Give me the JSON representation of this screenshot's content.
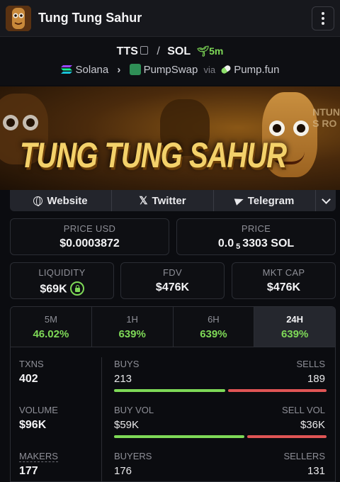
{
  "header": {
    "title": "Tung Tung Sahur"
  },
  "pair": {
    "base": "TTS",
    "separator": "/",
    "quote": "SOL",
    "age": "5m",
    "chain": "Solana",
    "dex": "PumpSwap",
    "via_label": "via",
    "launchpad": "Pump.fun"
  },
  "banner": {
    "title": "TUNG TUNG SAHUR",
    "side_text_1": "NTUN",
    "side_text_2": "S RO"
  },
  "links": {
    "website": "Website",
    "twitter": "Twitter",
    "telegram": "Telegram"
  },
  "price": {
    "usd_label": "PRICE USD",
    "usd_value": "$0.0003872",
    "native_label": "PRICE",
    "native_prefix": "0.0",
    "native_zeros": "5",
    "native_digits": "3303",
    "native_unit": "SOL"
  },
  "metrics": {
    "liquidity_label": "LIQUIDITY",
    "liquidity_value": "$69K",
    "fdv_label": "FDV",
    "fdv_value": "$476K",
    "mktcap_label": "MKT CAP",
    "mktcap_value": "$476K"
  },
  "timeframes": [
    {
      "label": "5M",
      "change": "46.02%"
    },
    {
      "label": "1H",
      "change": "639%"
    },
    {
      "label": "6H",
      "change": "639%"
    },
    {
      "label": "24H",
      "change": "639%"
    }
  ],
  "stats": {
    "txns_label": "TXNS",
    "txns_value": "402",
    "buys_label": "BUYS",
    "buys_value": "213",
    "sells_label": "SELLS",
    "sells_value": "189",
    "buys_fraction": 0.53,
    "volume_label": "VOLUME",
    "volume_value": "$96K",
    "buy_vol_label": "BUY VOL",
    "buy_vol_value": "$59K",
    "sell_vol_label": "SELL VOL",
    "sell_vol_value": "$36K",
    "buy_vol_fraction": 0.62,
    "makers_label": "MAKERS",
    "makers_value": "177",
    "buyers_label": "BUYERS",
    "buyers_value": "176",
    "sellers_label": "SELLERS",
    "sellers_value": "131"
  },
  "colors": {
    "positive": "#7ed957",
    "negative": "#e05555",
    "background": "#0b0c10"
  }
}
